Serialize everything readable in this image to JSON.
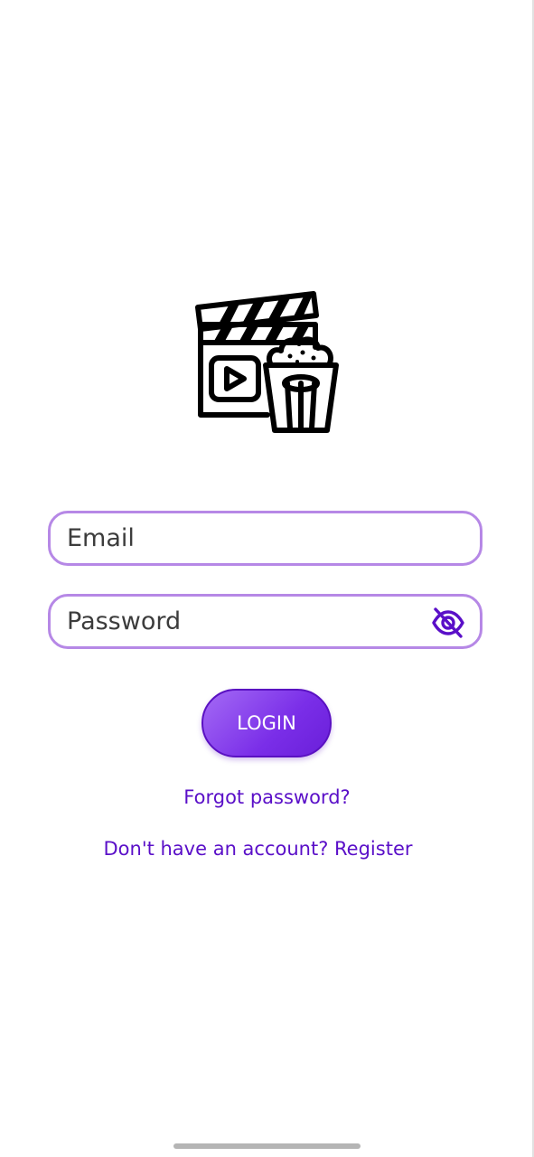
{
  "login_form": {
    "email": {
      "value": "",
      "placeholder": "Email"
    },
    "password": {
      "value": "",
      "placeholder": "Password",
      "visibility_icon": "eye-off-icon"
    },
    "login_label": "LOGIN",
    "forgot_password_label": "Forgot password?",
    "register_label": "Don't have an account? Register"
  },
  "logo": {
    "icon": "clapperboard-popcorn-icon"
  },
  "colors": {
    "accent": "#7a2ee8",
    "field_border": "#b688e6",
    "link": "#5a0fc8",
    "icon": "#000000"
  }
}
